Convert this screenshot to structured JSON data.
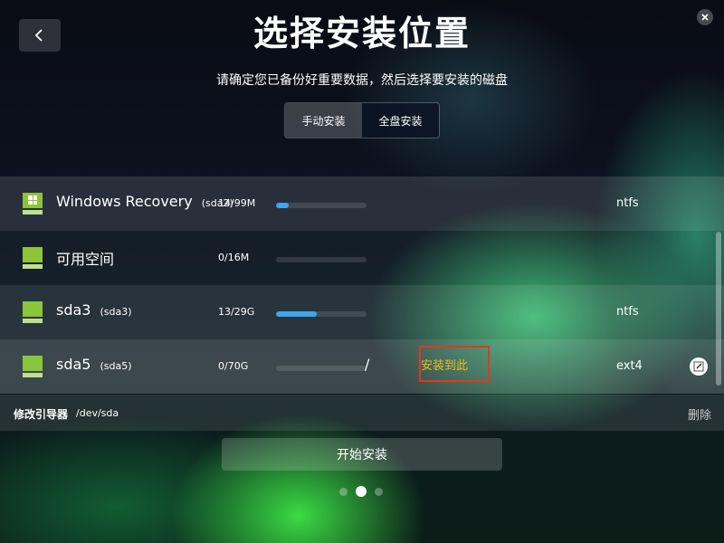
{
  "window": {
    "title": "选择安装位置",
    "subtitle": "请确定您已备份好重要数据，然后选择要安装的磁盘",
    "back_icon": "chevron-left-icon",
    "close_icon": "close-icon"
  },
  "mode_tabs": [
    {
      "label": "手动安装",
      "selected": true
    },
    {
      "label": "全盘安装",
      "selected": false
    }
  ],
  "partitions": [
    {
      "name": "Windows Recovery",
      "device": "(sda2)",
      "usage": "14/99M",
      "usage_fraction": 0.14,
      "filesystem": "ntfs",
      "mount": "",
      "os_icon": "windows-icon"
    },
    {
      "name": "可用空间",
      "device": "",
      "usage": "0/16M",
      "usage_fraction": 0,
      "filesystem": "",
      "mount": ""
    },
    {
      "name": "sda3",
      "device": "(sda3)",
      "usage": "13/29G",
      "usage_fraction": 0.45,
      "filesystem": "ntfs",
      "mount": ""
    },
    {
      "name": "sda5",
      "device": "(sda5)",
      "usage": "0/70G",
      "usage_fraction": 0,
      "filesystem": "ext4",
      "mount": "/",
      "target_label": "安装到此",
      "selected": true,
      "edit_icon": "edit-icon"
    }
  ],
  "bootloader": {
    "label": "修改引导器",
    "device": "/dev/sda",
    "delete_label": "删除"
  },
  "start_button": {
    "label": "开始安装"
  },
  "pager": {
    "total": 3,
    "current": 2
  },
  "colors": {
    "usage_bar": "#3fa6ef",
    "disk_icon": "#8cc43a",
    "target_border": "#e03a1c",
    "target_text": "#e8c023"
  }
}
